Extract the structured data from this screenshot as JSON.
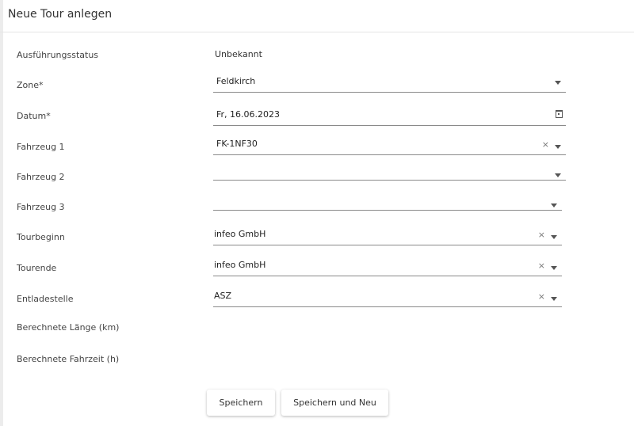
{
  "header": {
    "title": "Neue Tour anlegen"
  },
  "form": {
    "status": {
      "label": "Ausführungsstatus",
      "value": "Unbekannt"
    },
    "zone": {
      "label": "Zone*",
      "value": "Feldkirch"
    },
    "datum": {
      "label": "Datum*",
      "value": "Fr, 16.06.2023"
    },
    "fahrzeug1": {
      "label": "Fahrzeug 1",
      "value": "FK-1NF30",
      "clear": "×"
    },
    "fahrzeug2": {
      "label": "Fahrzeug 2",
      "value": ""
    },
    "fahrzeug3": {
      "label": "Fahrzeug 3",
      "value": ""
    },
    "tourbeginn": {
      "label": "Tourbeginn",
      "value": "infeo GmbH",
      "clear": "×"
    },
    "tourende": {
      "label": "Tourende",
      "value": "infeo GmbH",
      "clear": "×"
    },
    "entladestelle": {
      "label": "Entladestelle",
      "value": "ASZ",
      "clear": "×"
    },
    "laenge": {
      "label": "Berechnete Länge (km)"
    },
    "fahrzeit": {
      "label": "Berechnete Fahrzeit (h)"
    }
  },
  "buttons": {
    "save": "Speichern",
    "save_new": "Speichern und Neu"
  },
  "icons": {
    "dropdown": "chevron-down-icon",
    "clear": "close-icon",
    "calendar": "calendar-icon"
  }
}
